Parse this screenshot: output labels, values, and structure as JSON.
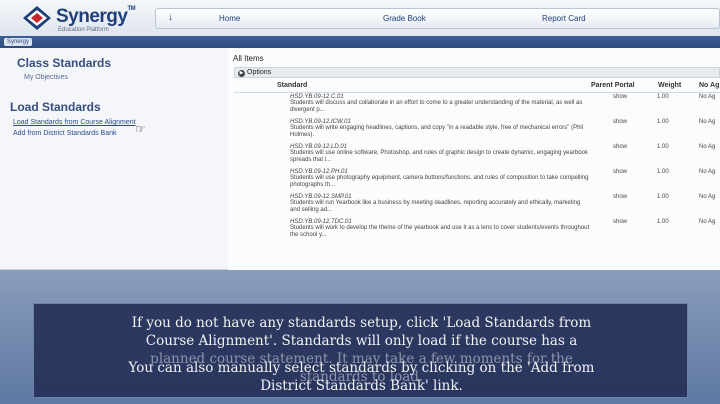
{
  "header": {
    "brand": "Synergy",
    "brand_sub": "Education Platform",
    "nav": [
      "Home",
      "Grade Book",
      "Report Card"
    ]
  },
  "strip_tag": "Synergy",
  "left": {
    "class_standards": "Class Standards",
    "my_objectives": "My Objectives",
    "load_standards": "Load Standards",
    "link_course_alignment": "Load Standards from Course Alignment",
    "link_district_bank": "Add from District Standards Bank"
  },
  "right": {
    "all_items": "All Items",
    "options": "Options",
    "columns": {
      "standard": "Standard",
      "parent_portal": "Parent Portal",
      "weight": "Weight",
      "no_ag": "No Ag"
    },
    "rows": [
      {
        "code": "HSD.YB.09-12.C.01",
        "desc": "Students will discuss and collaborate in an effort to come to a greater understanding of the material, as well as divergent p...",
        "show": "show",
        "weight": "1.00",
        "noag": "No Ag"
      },
      {
        "code": "HSD.YB.09-12.ICW.01",
        "desc": "Students will write engaging headlines, captions, and copy \"in a readable style, free of mechanical errors\" (Phil Holmes).",
        "show": "show",
        "weight": "1.00",
        "noag": "No Ag"
      },
      {
        "code": "HSD.YB.09-12.LD.01",
        "desc": "Students will use online software, Photoshop, and rules of graphic design to create dynamic, engaging yearbook spreads that l...",
        "show": "show",
        "weight": "1.00",
        "noag": "No Ag"
      },
      {
        "code": "HSD.YB.09-12.PH.01",
        "desc": "Students will use photography equipment, camera buttons/functions, and rules of composition to take compelling photographs th...",
        "show": "show",
        "weight": "1.00",
        "noag": "No Ag"
      },
      {
        "code": "HSD.YB.09-12.SMP.01",
        "desc": "Students will run Yearbook like a business by meeting deadlines, reporting accurately and ethically, marketing and selling ad...",
        "show": "show",
        "weight": "1.00",
        "noag": "No Ag"
      },
      {
        "code": "HSD.YB.09-12.TDC.01",
        "desc": "Students will work to develop the theme of the yearbook and use it as a lens to cover students/events throughout the school y...",
        "show": "show",
        "weight": "1.00",
        "noag": "No Ag"
      }
    ]
  },
  "caption": {
    "line1": "If you do not have any standards setup, click 'Load Standards from",
    "line2": "Course Alignment'.   Standards will only load if the course has a",
    "line3": "planned course statement.  It may take a few moments for the",
    "line4": "You can also manually select standards by clicking on the 'Add from",
    "line5": "standards to load.",
    "line6": "District Standards Bank' link."
  }
}
